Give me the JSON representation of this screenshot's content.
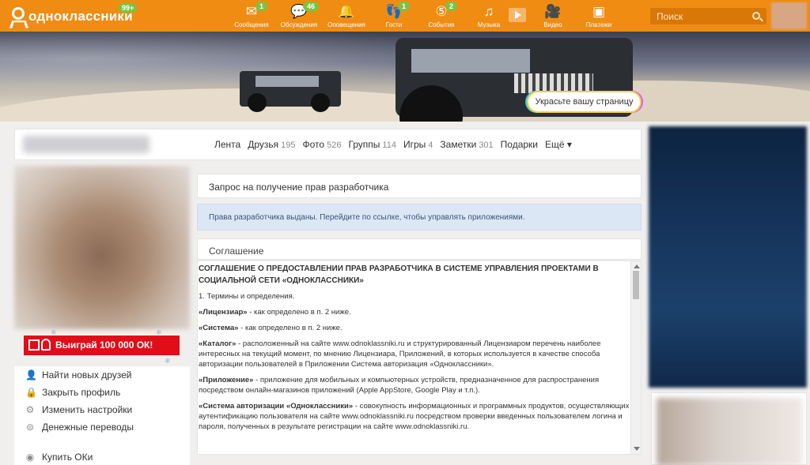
{
  "header": {
    "logo_text": "одноклассники",
    "logo_badge": "99+",
    "nav": [
      {
        "label": "Сообщения",
        "badge": "1",
        "icon": "envelope-icon"
      },
      {
        "label": "Обсуждения",
        "badge": "46",
        "icon": "chat-bubbles-icon"
      },
      {
        "label": "Оповещения",
        "badge": "",
        "icon": "bell-icon"
      },
      {
        "label": "Гости",
        "badge": "1",
        "icon": "footprints-icon"
      },
      {
        "label": "События",
        "badge": "2",
        "icon": "events-five-icon"
      },
      {
        "label": "Музыка",
        "badge": "",
        "icon": "music-note-icon"
      },
      {
        "label": "Видео",
        "badge": "",
        "icon": "video-camera-icon"
      },
      {
        "label": "Платежи",
        "badge": "",
        "icon": "wallet-icon"
      }
    ],
    "search_placeholder": "Поиск"
  },
  "banner": {
    "decorate_label": "Украсьте вашу страницу"
  },
  "profile_tabs": [
    {
      "label": "Лента",
      "count": ""
    },
    {
      "label": "Друзья",
      "count": "195"
    },
    {
      "label": "Фото",
      "count": "526"
    },
    {
      "label": "Группы",
      "count": "114"
    },
    {
      "label": "Игры",
      "count": "4"
    },
    {
      "label": "Заметки",
      "count": "301"
    },
    {
      "label": "Подарки",
      "count": ""
    },
    {
      "label": "Ещё",
      "count": ""
    }
  ],
  "promo_label": "Выиграй 100 000 ОК!",
  "left_menu": [
    {
      "label": "Найти новых друзей",
      "icon": "person-icon"
    },
    {
      "label": "Закрыть профиль",
      "icon": "lock-icon"
    },
    {
      "label": "Изменить настройки",
      "icon": "gear-icon"
    },
    {
      "label": "Денежные переводы",
      "icon": "money-transfer-icon"
    },
    {
      "label": "Купить ОКи",
      "icon": "ok-coin-icon"
    }
  ],
  "center": {
    "request_title": "Запрос на получение прав разработчика",
    "notice": "Права разработчика выданы. Перейдите по ссылке, чтобы управлять приложениями.",
    "agreement_heading": "Соглашение",
    "agreement_title": "СОГЛАШЕНИЕ О ПРЕДОСТАВЛЕНИИ ПРАВ РАЗРАБОТЧИКА В СИСТЕМЕ УПРАВЛЕНИЯ ПРОЕКТАМИ В СОЦИАЛЬНОЙ СЕТИ «ОДНОКЛАССНИКИ»",
    "section_1": "1. Термины и определения.",
    "terms": [
      {
        "term": "«Лицензиар»",
        "text": " - как определено в п. 2 ниже."
      },
      {
        "term": "«Система»",
        "text": " - как определено в п. 2 ниже."
      },
      {
        "term": "«Каталог»",
        "text": " - расположенный на сайте www.odnoklassniki.ru и структурированный Лицензиаром перечень наиболее интересных на текущий момент, по мнению Лицензиара, Приложений, в которых используется в качестве способа авторизации пользователей в Приложении Система авторизация «Одноклассники»."
      },
      {
        "term": "«Приложение»",
        "text": " - приложение для мобильных и компьютерных устройств, предназначенное для распространения посредством онлайн-магазинов приложений (Apple AppStore, Google Play и т.п.)."
      },
      {
        "term": "«Система авторизации «Одноклассники»",
        "text": " - совокупность информационных и программных продуктов, осуществляющих аутентификацию пользователя на сайте www.odnoklassniki.ru посредством проверки введенных пользователем логина и пароля, полученных в результате регистрации на сайте www.odnoklassniki.ru."
      }
    ]
  },
  "colors": {
    "accent": "#f08c12",
    "badge": "#7dc242",
    "promo": "#e10d19",
    "notice_bg": "#dbe7f5"
  }
}
